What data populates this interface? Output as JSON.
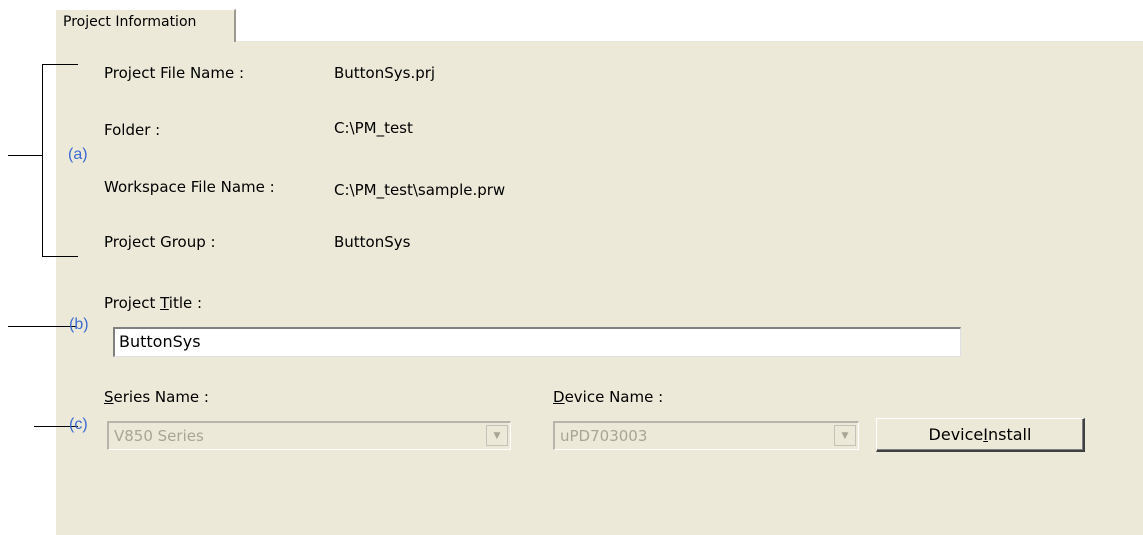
{
  "tab": {
    "label": "Project Information"
  },
  "info": {
    "project_file_name_label": "Project File Name :",
    "project_file_name_value": "ButtonSys.prj",
    "folder_label": "Folder :",
    "folder_value": "C:\\PM_test",
    "workspace_label": "Workspace File Name :",
    "workspace_value": "C:\\PM_test\\sample.prw",
    "group_label": "Project Group :",
    "group_value": "ButtonSys"
  },
  "title": {
    "label_prefix": "Project ",
    "label_accel": "T",
    "label_suffix": "itle :",
    "value": "ButtonSys"
  },
  "series": {
    "label_accel": "S",
    "label_suffix": "eries Name :",
    "value": "V850 Series"
  },
  "device": {
    "label_accel": "D",
    "label_suffix": "evice Name :",
    "value": "uPD703003",
    "install_accel_prefix": "Device ",
    "install_accel": "I",
    "install_suffix": "nstall"
  },
  "annotations": {
    "a": "(a)",
    "b": "(b)",
    "c": "(c)"
  },
  "colors": {
    "panel": "#ece9d8",
    "annotation": "#3a6bd0"
  }
}
